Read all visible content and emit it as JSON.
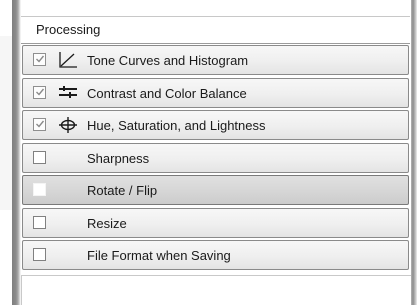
{
  "panel": {
    "title": "Processing"
  },
  "items": [
    {
      "label": "Tone Curves and Histogram",
      "checked": true,
      "icon": "tone-curve-icon",
      "selected": false
    },
    {
      "label": "Contrast and Color Balance",
      "checked": true,
      "icon": "contrast-sliders-icon",
      "selected": false
    },
    {
      "label": "Hue, Saturation, and Lightness",
      "checked": true,
      "icon": "hue-saturation-icon",
      "selected": false
    },
    {
      "label": "Sharpness",
      "checked": false,
      "icon": "",
      "selected": false
    },
    {
      "label": "Rotate / Flip",
      "checked": false,
      "icon": "",
      "selected": true
    },
    {
      "label": "Resize",
      "checked": false,
      "icon": "",
      "selected": false
    },
    {
      "label": "File Format when Saving",
      "checked": false,
      "icon": "",
      "selected": false
    }
  ],
  "colors": {
    "row_background": "#efefef",
    "row_selected_background": "#d6d6d6",
    "row_border": "#8a8a8a",
    "frame": "#8c8c8c"
  }
}
